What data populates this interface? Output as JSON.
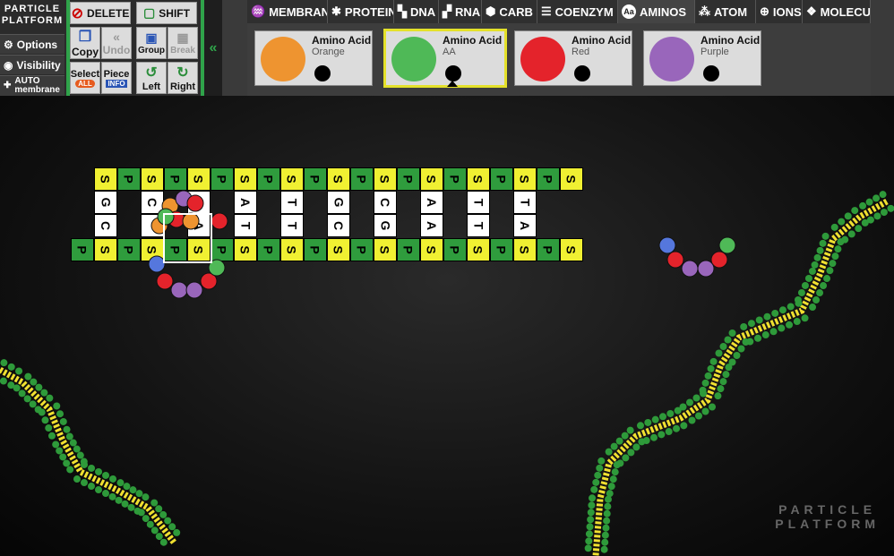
{
  "logo": {
    "line1": "PARTICLE",
    "line2": "PLATFORM"
  },
  "left_menu": {
    "options": "Options",
    "visibility": "Visibility",
    "auto_line1": "AUTO",
    "auto_line2": "membrane"
  },
  "toolbar": {
    "delete": "DELETE",
    "shift": "SHIFT",
    "copy": "Copy",
    "undo": "Undo",
    "group": "Group",
    "break": "Break",
    "select": "Select",
    "select_badge": "ALL",
    "piece": "Piece",
    "piece_badge": "INFO",
    "left": "Left",
    "right": "Right"
  },
  "tabs": [
    {
      "label": "MEMBRAN",
      "icon": "membrane-icon"
    },
    {
      "label": "PROTEIN",
      "icon": "protein-icon"
    },
    {
      "label": "DNA",
      "icon": "dna-icon"
    },
    {
      "label": "RNA",
      "icon": "rna-icon"
    },
    {
      "label": "CARB",
      "icon": "carb-icon"
    },
    {
      "label": "COENZYM",
      "icon": "coenzyme-icon"
    },
    {
      "label": "AMINOS",
      "icon": "aminos-icon",
      "active": true
    },
    {
      "label": "ATOM",
      "icon": "atom-icon"
    },
    {
      "label": "IONS",
      "icon": "ions-icon"
    },
    {
      "label": "MOLECU",
      "icon": "molecule-icon"
    }
  ],
  "palette": [
    {
      "title": "Amino Acid",
      "subtitle": "Orange",
      "color": "#ee9430"
    },
    {
      "title": "Amino Acid",
      "subtitle": "AA",
      "color": "#4fb957",
      "selected": true
    },
    {
      "title": "Amino Acid",
      "subtitle": "Red",
      "color": "#e4232b"
    },
    {
      "title": "Amino Acid",
      "subtitle": "Purple",
      "color": "#9966bb"
    }
  ],
  "dna": {
    "top_row": [
      "S",
      "P",
      "S",
      "P",
      "S",
      "P",
      "S",
      "P",
      "S",
      "P",
      "S",
      "P",
      "S",
      "P",
      "S",
      "P",
      "S",
      "P",
      "S",
      "P",
      "S"
    ],
    "top_bases": [
      "G",
      "C",
      "",
      "A",
      "T",
      "G",
      "C",
      "A",
      "T",
      "T"
    ],
    "bottom_bases": [
      "C",
      "",
      "A",
      "T",
      "T",
      "C",
      "G",
      "A",
      "T",
      "A"
    ],
    "bottom_row": [
      "P",
      "S",
      "P",
      "S",
      "P",
      "S",
      "P",
      "S",
      "P",
      "S",
      "P",
      "S",
      "P",
      "S",
      "P",
      "S",
      "P",
      "S",
      "P",
      "S",
      "P",
      "S"
    ]
  },
  "watermark": {
    "line1": "PARTICLE",
    "line2": "PLATFORM"
  },
  "colors": {
    "orange": "#ee9430",
    "green": "#4fb957",
    "red": "#e4232b",
    "purple": "#9966bb",
    "blue": "#5577dd",
    "membrane_green": "#2e9a3a",
    "membrane_yellow": "#f0e030"
  }
}
